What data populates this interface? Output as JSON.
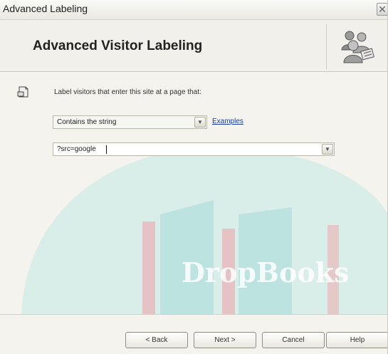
{
  "window": {
    "title": "Advanced Labeling",
    "close_glyph": "✕"
  },
  "header": {
    "title": "Advanced Visitor Labeling",
    "icon": "people-group-icon"
  },
  "form": {
    "prompt": "Label visitors that enter this site at a page that:",
    "match_select": {
      "value": "Contains the string"
    },
    "examples_link": "Examples",
    "string_input": {
      "value": "?src=google"
    }
  },
  "watermark": {
    "text": "DropBooks"
  },
  "buttons": {
    "back": "< Back",
    "next": "Next >",
    "cancel": "Cancel",
    "help": "Help"
  },
  "colors": {
    "watermark_teal": "#7ccfca",
    "watermark_red": "#c84b52"
  }
}
